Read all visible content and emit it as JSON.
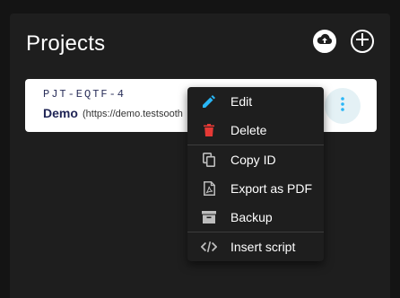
{
  "header": {
    "title": "Projects"
  },
  "actions": {
    "upload_icon": "cloud-upload-icon",
    "add_icon": "plus-circle-icon"
  },
  "project": {
    "id": "PJT-EQTF-4",
    "name": "Demo",
    "url": "(https://demo.testsooth"
  },
  "menu": {
    "items": [
      {
        "label": "Edit",
        "icon": "pencil-icon",
        "color": "#29b6f6"
      },
      {
        "label": "Delete",
        "icon": "trash-icon",
        "color": "#e53935"
      },
      {
        "label": "Copy ID",
        "icon": "copy-icon",
        "color": "#bdbdbd"
      },
      {
        "label": "Export as PDF",
        "icon": "pdf-icon",
        "color": "#bdbdbd"
      },
      {
        "label": "Backup",
        "icon": "archive-icon",
        "color": "#bdbdbd"
      },
      {
        "label": "Insert script",
        "icon": "code-icon",
        "color": "#bdbdbd"
      }
    ]
  },
  "colors": {
    "accent": "#29b6f6",
    "danger": "#e53935",
    "card_title": "#1f2455"
  }
}
